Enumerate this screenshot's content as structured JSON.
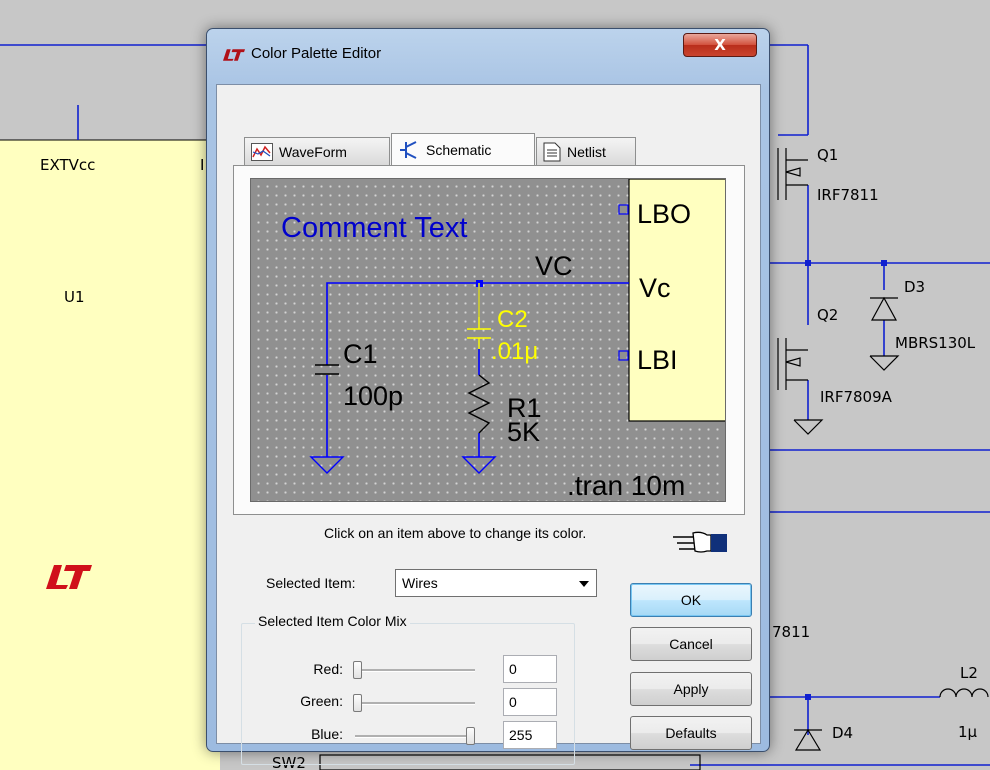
{
  "window": {
    "title": "Color Palette Editor",
    "close_glyph": "X"
  },
  "background": {
    "labels": {
      "extvcc": "EXTVcc",
      "u1": "U1",
      "partial_i": "I",
      "q1": "Q1",
      "irf7811": "IRF7811",
      "d3": "D3",
      "q2": "Q2",
      "mbrs": "MBRS130L",
      "irf7809a": "IRF7809A",
      "partial_7811": "7811",
      "l2": "L2",
      "l2_val": "1μ",
      "d4": "D4",
      "sw2": "SW2"
    }
  },
  "tabs": [
    {
      "label": "WaveForm",
      "icon": "waveform-icon",
      "active": false
    },
    {
      "label": "Schematic",
      "icon": "schematic-icon",
      "active": true
    },
    {
      "label": "Netlist",
      "icon": "netlist-icon",
      "active": false
    }
  ],
  "preview": {
    "comment_text": "Comment Text",
    "net_label": "VC",
    "pin_lbo": "LBO",
    "pin_vc": "Vc",
    "pin_lbi": "LBI",
    "c1_name": "C1",
    "c1_value": "100p",
    "c2_name": "C2",
    "c2_value": ".01μ",
    "r1_name": "R1",
    "r1_value": "5K",
    "directive": ".tran 10m",
    "colors": {
      "background": "#909090",
      "wires": "#0000ff",
      "comment": "#0000cc",
      "component": "#000000",
      "selected": "#ffff00",
      "symbol_fill": "#ffffc0"
    }
  },
  "hint": "Click on an item above to change its color.",
  "selected_item": {
    "label": "Selected Item:",
    "value": "Wires"
  },
  "color_mix": {
    "group_label": "Selected Item Color Mix",
    "red": {
      "label": "Red:",
      "value": "0",
      "level": 0
    },
    "green": {
      "label": "Green:",
      "value": "0",
      "level": 0
    },
    "blue": {
      "label": "Blue:",
      "value": "255",
      "level": 1
    }
  },
  "buttons": {
    "ok": "OK",
    "cancel": "Cancel",
    "apply": "Apply",
    "defaults": "Defaults"
  }
}
